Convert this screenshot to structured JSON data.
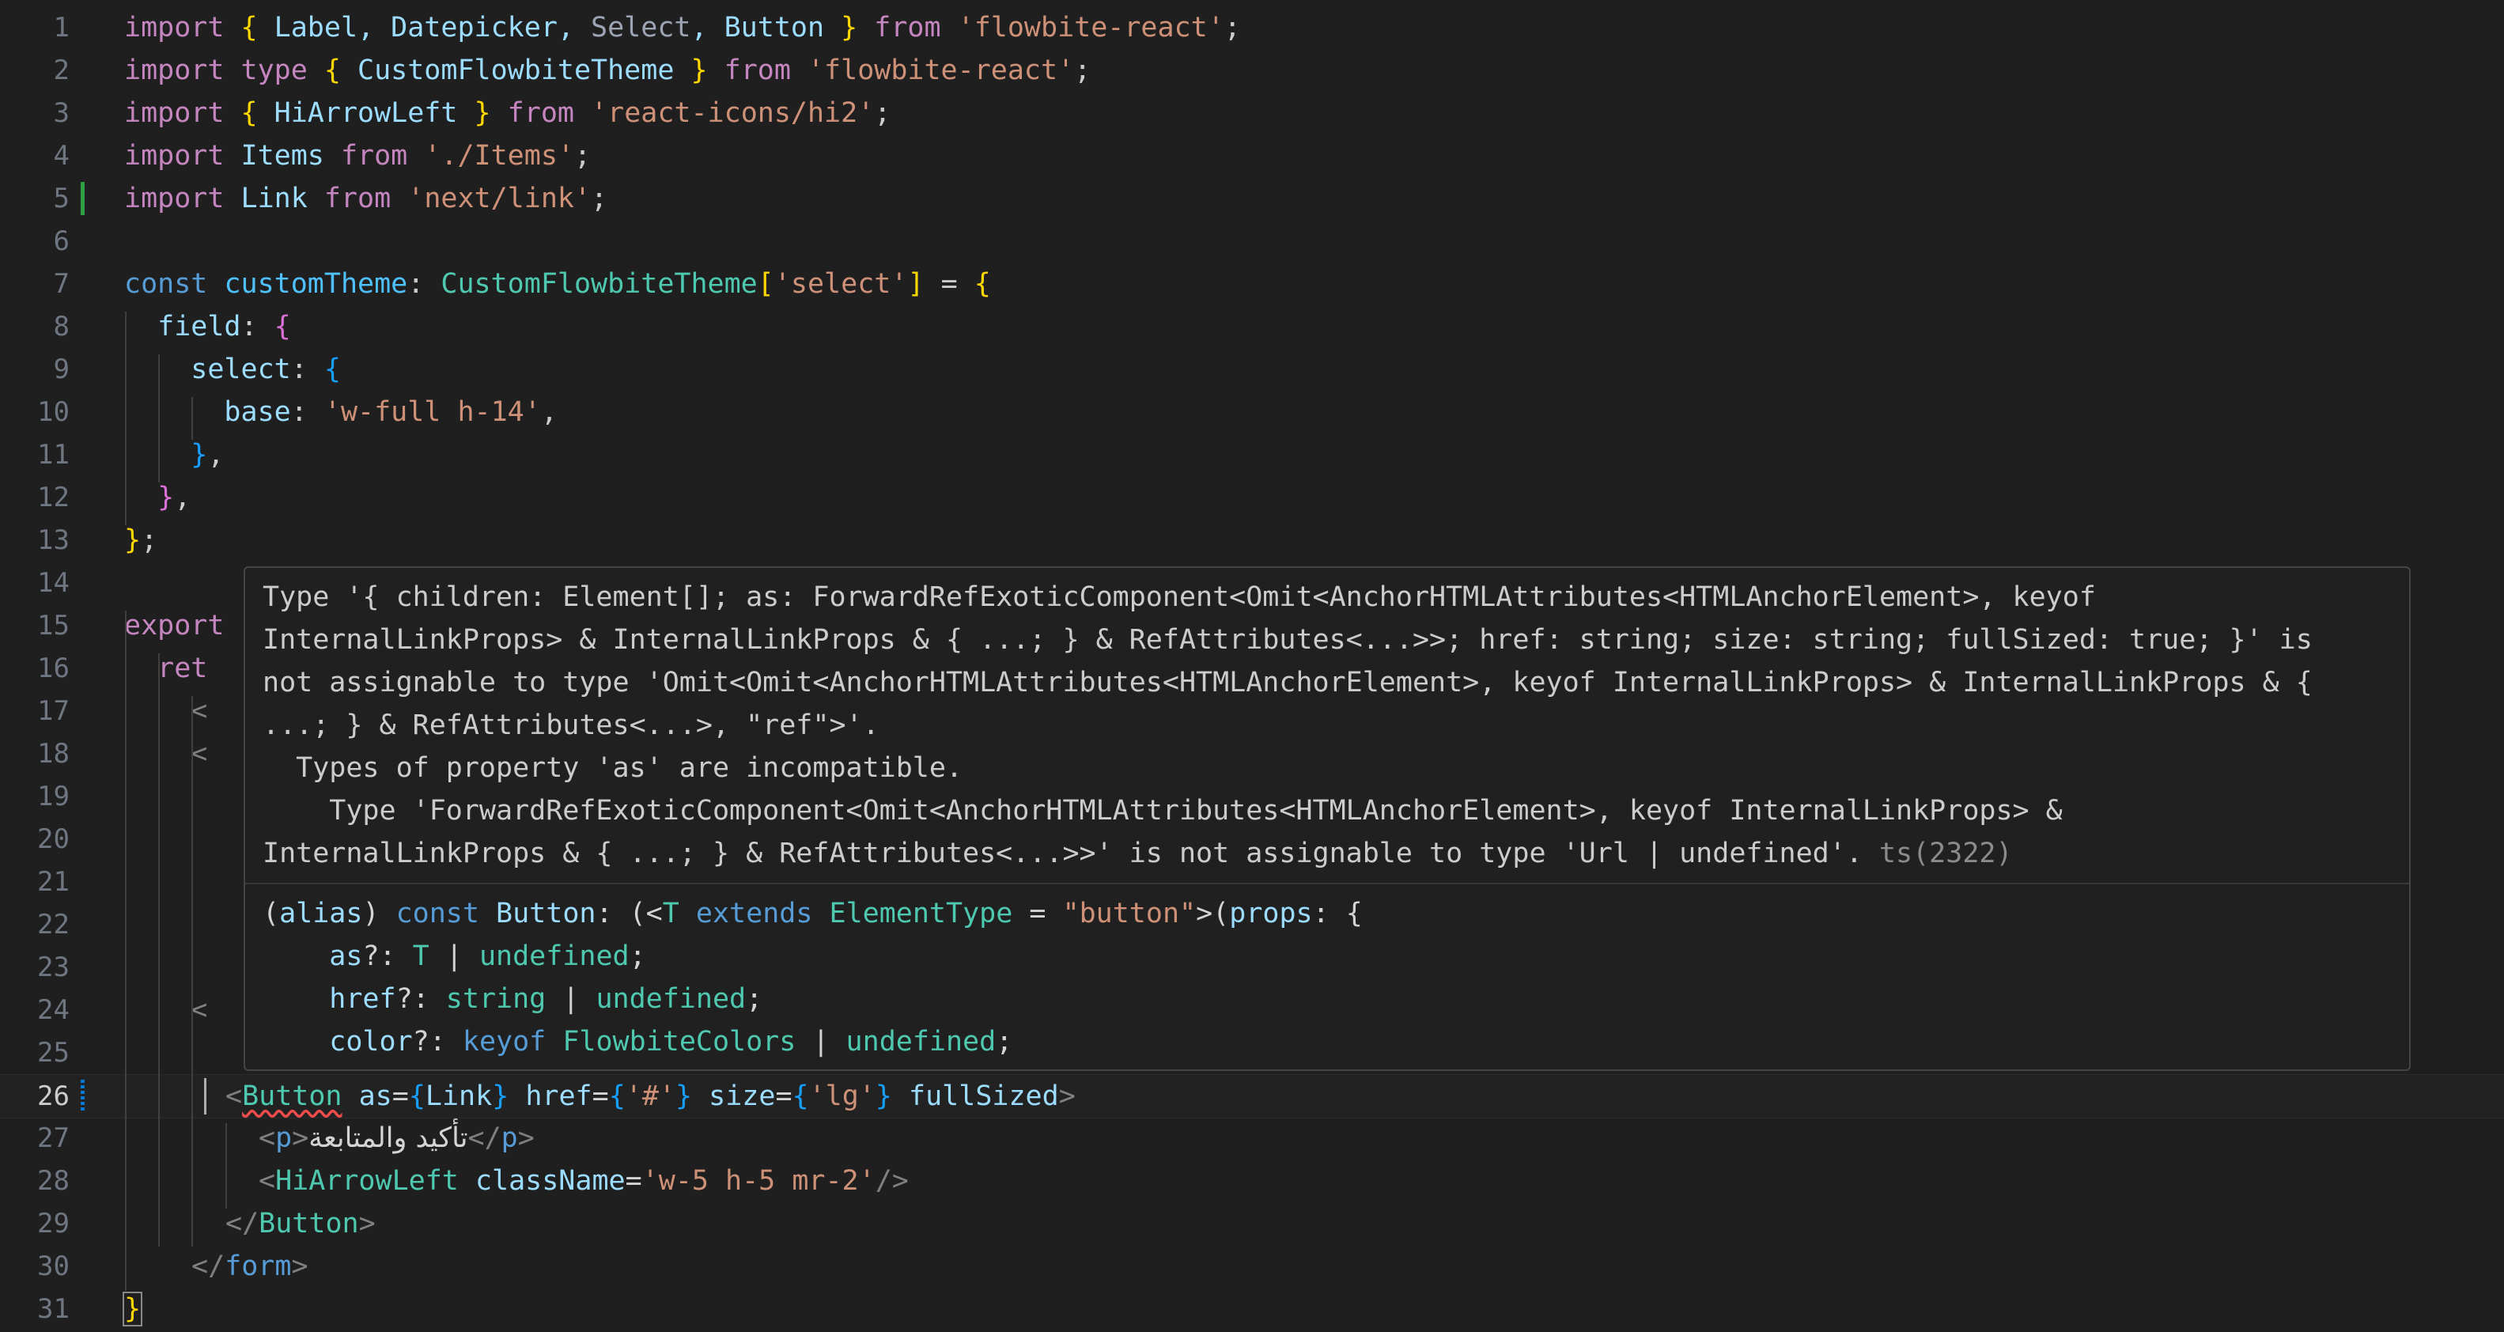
{
  "editor": {
    "line_numbers": [
      "1",
      "2",
      "3",
      "4",
      "5",
      "6",
      "7",
      "8",
      "9",
      "10",
      "11",
      "12",
      "13",
      "14",
      "15",
      "16",
      "17",
      "18",
      "19",
      "20",
      "21",
      "22",
      "23",
      "24",
      "25",
      "26",
      "27",
      "28",
      "29",
      "30",
      "31"
    ],
    "lines": {
      "l1": [
        "import",
        " ",
        "{",
        " Label, Datepicker, ",
        "Select",
        ", Button ",
        "}",
        " from ",
        "'flowbite-react'",
        ";"
      ],
      "l2": [
        "import type ",
        "{",
        " CustomFlowbiteTheme ",
        "}",
        " from ",
        "'flowbite-react'",
        ";"
      ],
      "l3": [
        "import ",
        "{",
        " HiArrowLeft ",
        "}",
        " from ",
        "'react-icons/hi2'",
        ";"
      ],
      "l4": [
        "import ",
        "Items",
        " from ",
        "'./Items'",
        ";"
      ],
      "l5": [
        "import ",
        "Link",
        " from ",
        "'next/link'",
        ";"
      ],
      "l7": [
        "const ",
        "customTheme",
        ": ",
        "CustomFlowbiteTheme",
        "[",
        "'select'",
        "]",
        " = ",
        "{"
      ],
      "l8": [
        "  field",
        ": ",
        "{"
      ],
      "l9": [
        "    select",
        ": ",
        "{"
      ],
      "l10": [
        "      base",
        ": ",
        "'w-full h-14'",
        ","
      ],
      "l11": [
        "    ",
        "}",
        ","
      ],
      "l12": [
        "  ",
        "}",
        ","
      ],
      "l13": [
        "}",
        ";"
      ],
      "l15": [
        "export"
      ],
      "l16": [
        "  ret"
      ],
      "l17": [
        "    <"
      ],
      "l18": [
        "    <"
      ],
      "l24": [
        "    <"
      ],
      "l26": [
        "<",
        "Button",
        " as",
        "=",
        "{",
        "Link",
        "}",
        " href",
        "=",
        "{",
        "'#'",
        "}",
        " size",
        "=",
        "{",
        "'lg'",
        "}",
        " fullSized",
        ">"
      ],
      "l27": [
        "<",
        "p",
        ">",
        "تأكيد والمتابعة",
        "</",
        "p",
        ">"
      ],
      "l28": [
        "<",
        "HiArrowLeft",
        " className",
        "=",
        "'w-5 h-5 mr-2'",
        "/>"
      ],
      "l29": [
        "</",
        "Button",
        ">"
      ],
      "l30": [
        "</",
        "form",
        ">"
      ],
      "l31": [
        "}"
      ]
    }
  },
  "hover": {
    "error_lines": [
      "Type '{ children: Element[]; as: ForwardRefExoticComponent<Omit<AnchorHTMLAttributes<HTMLAnchorElement>, keyof",
      "InternalLinkProps> & InternalLinkProps & { ...; } & RefAttributes<...>>; href: string; size: string; fullSized: true; }' is",
      "not assignable to type 'Omit<Omit<AnchorHTMLAttributes<HTMLAnchorElement>, keyof InternalLinkProps> & InternalLinkProps & {",
      "...; } & RefAttributes<...>, \"ref\">'.",
      "  Types of property 'as' are incompatible.",
      "    Type 'ForwardRefExoticComponent<Omit<AnchorHTMLAttributes<HTMLAnchorElement>, keyof InternalLinkProps> &",
      "InternalLinkProps & { ...; } & RefAttributes<...>>' is not assignable to type 'Url | undefined'. "
    ],
    "error_code": "ts(2322)",
    "sig": {
      "l1": [
        "(",
        "alias",
        ") ",
        "const ",
        "Button",
        ": (<",
        "T",
        " extends ",
        "ElementType",
        " = ",
        "\"button\"",
        ">(",
        "props",
        ": {"
      ],
      "l2": [
        "    as",
        "?: ",
        "T",
        " | ",
        "undefined",
        ";"
      ],
      "l3": [
        "    href",
        "?: ",
        "string",
        " | ",
        "undefined",
        ";"
      ],
      "l4": [
        "    color",
        "?: ",
        "keyof ",
        "FlowbiteColors",
        " | ",
        "undefined",
        ";"
      ]
    }
  },
  "colors": {
    "background": "#1f1f1f",
    "keyword": "#c586c0",
    "string": "#ce9178",
    "type": "#4ec9b0",
    "variable": "#9cdcfe",
    "error_squiggle": "#f14c4c",
    "git_added": "#2ea043",
    "git_modified": "#0078d4"
  }
}
